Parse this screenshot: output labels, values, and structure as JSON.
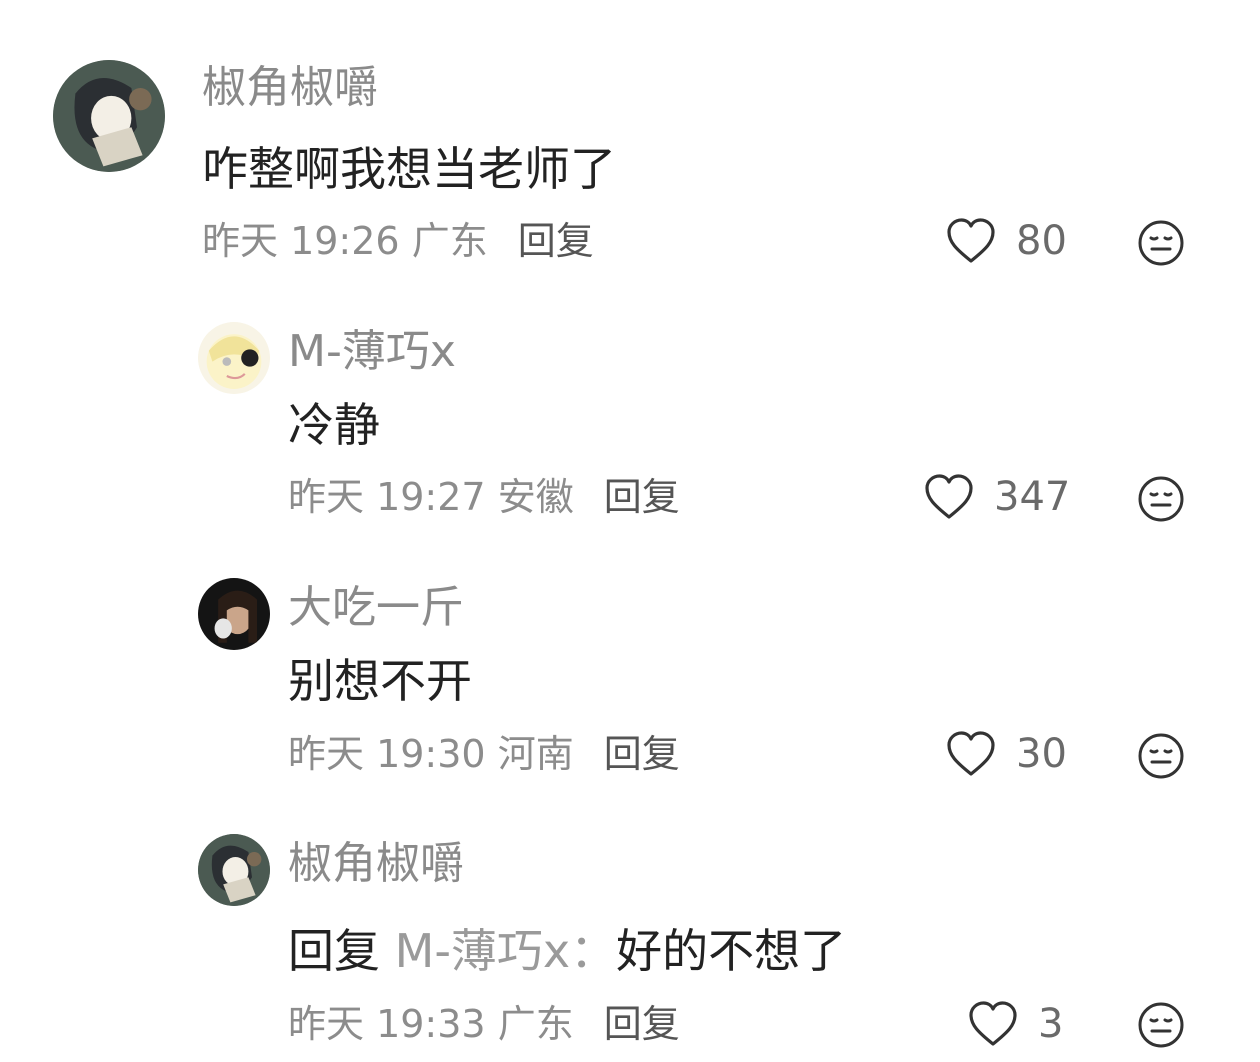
{
  "comments": [
    {
      "username": "椒角椒嚼",
      "text": "咋整啊我想当老师了",
      "time": "昨天 19:26",
      "location": "广东",
      "reply_label": "回复",
      "likes": "80"
    },
    {
      "username": "M-薄巧x",
      "text": "冷静",
      "time": "昨天 19:27",
      "location": "安徽",
      "reply_label": "回复",
      "likes": "347"
    },
    {
      "username": "大吃一斤",
      "text": "别想不开",
      "time": "昨天 19:30",
      "location": "河南",
      "reply_label": "回复",
      "likes": "30"
    },
    {
      "username": "椒角椒嚼",
      "reply_prefix": "回复",
      "reply_target": "M-薄巧x：",
      "text": "好的不想了",
      "time": "昨天 19:33",
      "location": "广东",
      "reply_label": "回复",
      "likes": "3"
    }
  ],
  "icons": {
    "like": "heart-outline-icon",
    "reaction": "neutral-face-icon"
  },
  "colors": {
    "username": "#8a8a8a",
    "text": "#222222",
    "meta": "#8c8c8c"
  }
}
